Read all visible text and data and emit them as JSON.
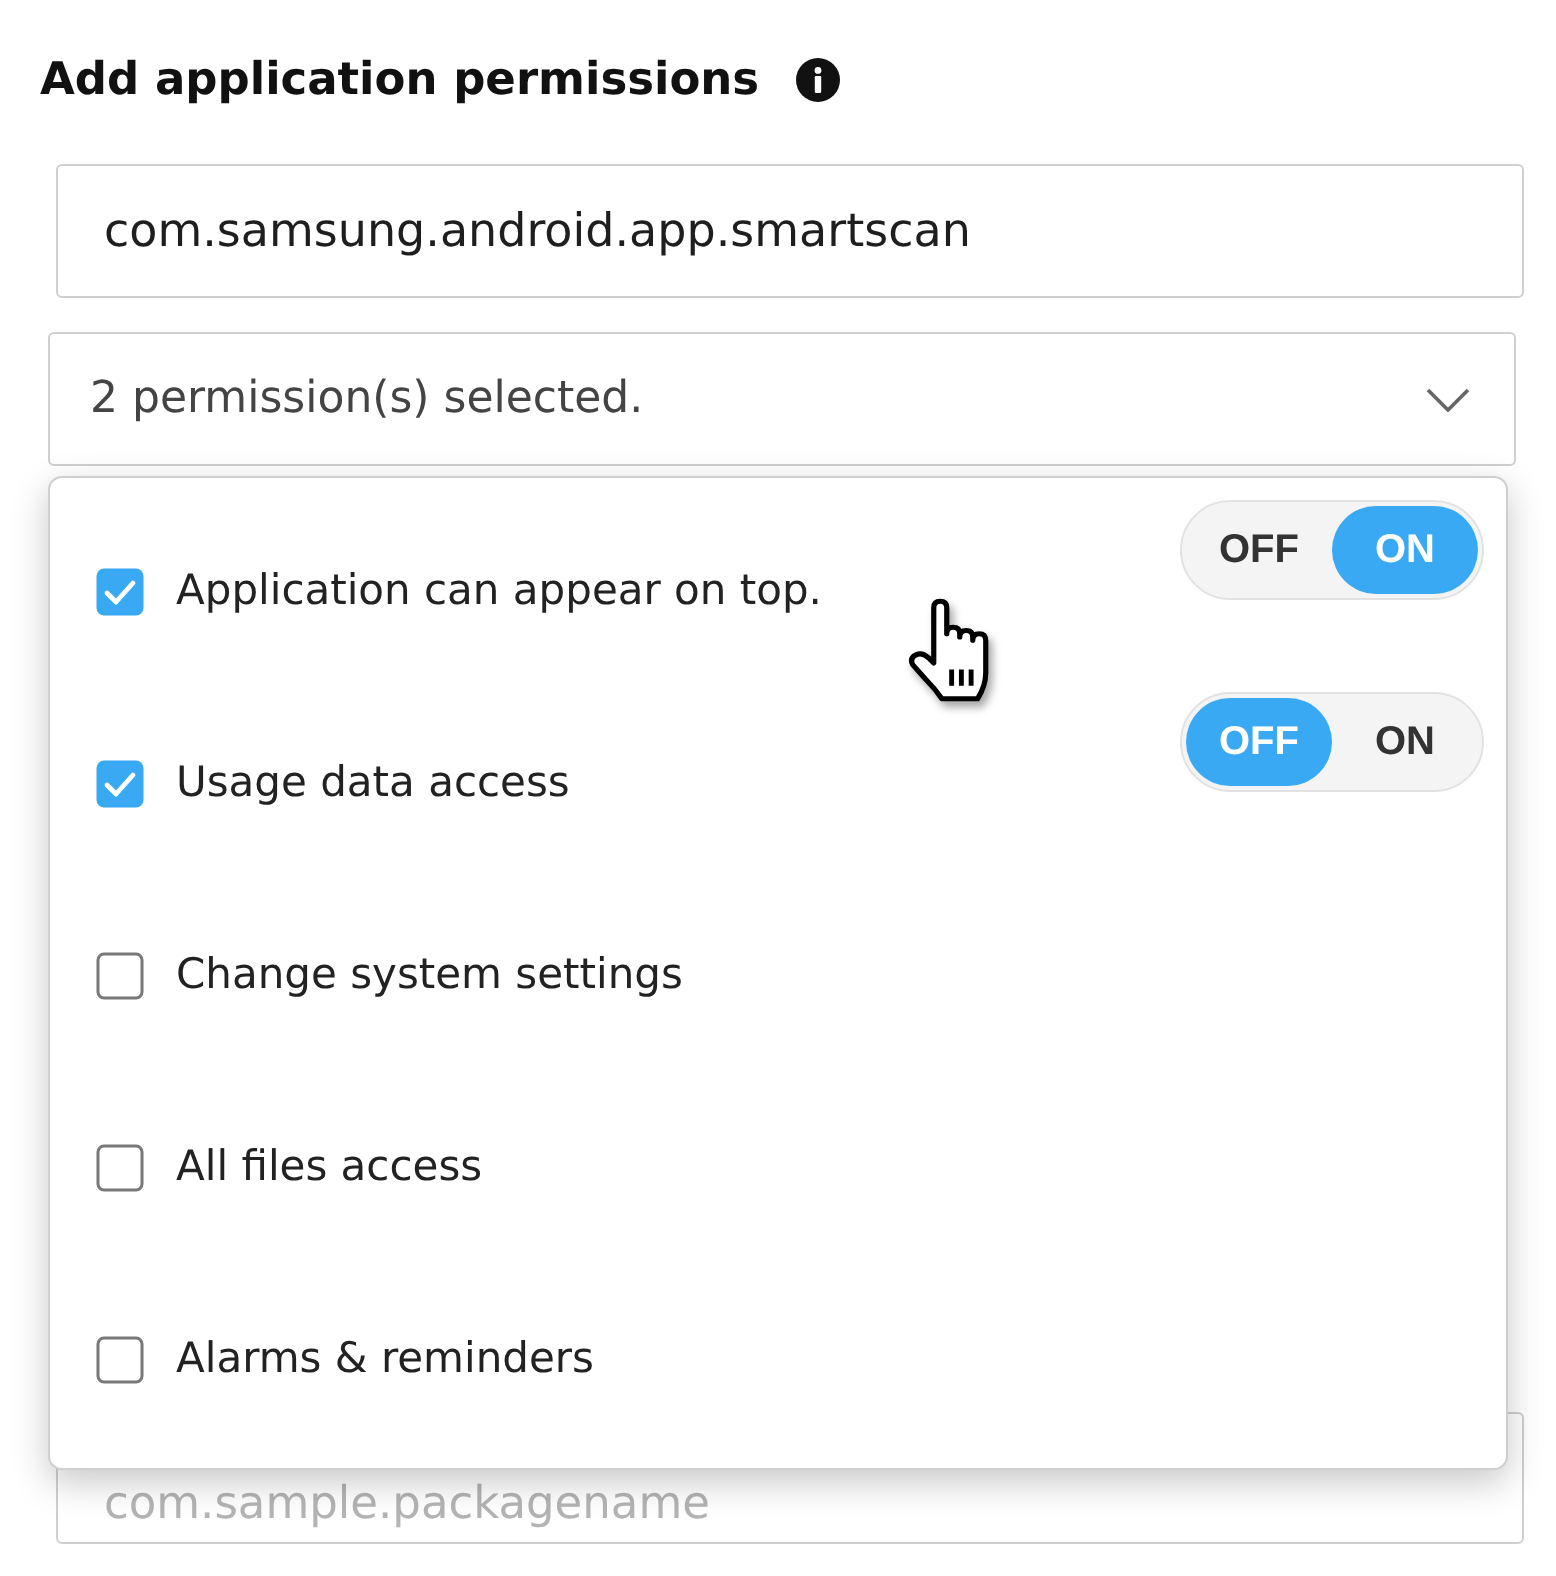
{
  "title": "Add application permissions",
  "package_field": {
    "value": "com.samsung.android.app.smartscan"
  },
  "permissions_select": {
    "value": "2 permission(s) selected.",
    "expanded": true
  },
  "permissions": [
    {
      "label": "Application can appear on top.",
      "checked": true,
      "kind": "toggle",
      "toggle": [
        {
          "label": "OFF",
          "selected": false
        },
        {
          "label": "ON",
          "selected": true
        }
      ]
    },
    {
      "label": "Usage data access",
      "checked": true,
      "kind": "toggle",
      "toggle": [
        {
          "label": "OFF",
          "selected": true
        },
        {
          "label": "ON",
          "selected": false
        }
      ]
    },
    {
      "label": "Change system settings",
      "checked": false,
      "kind": "plain"
    },
    {
      "label": "All files access",
      "checked": false,
      "kind": "plain"
    },
    {
      "label": "Alarms & reminders",
      "checked": false,
      "kind": "plain"
    }
  ],
  "package_field_2": {
    "placeholder": "com.sample.packagename"
  }
}
